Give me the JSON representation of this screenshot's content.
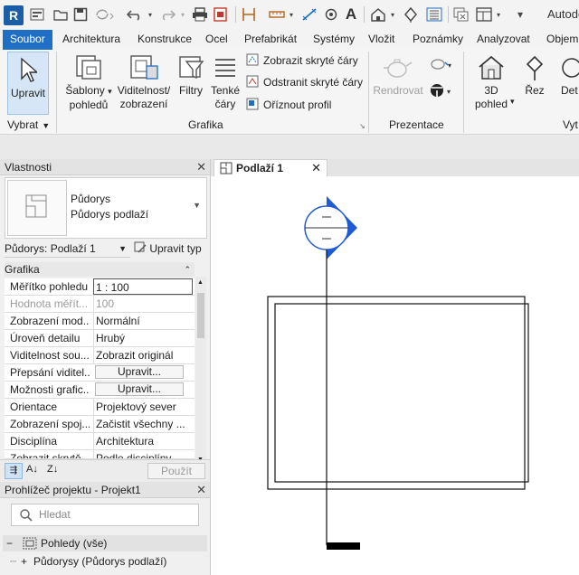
{
  "app": {
    "logo": "R",
    "title": "Autodesk"
  },
  "quick_access": {
    "icons": [
      "info-center-icon",
      "open-icon",
      "save-icon",
      "sync-icon",
      "undo-icon",
      "redo-icon",
      "print-icon",
      "sheet-icon",
      "measure-icon",
      "dimension-icon",
      "tag-icon",
      "text-icon",
      "home-3d-icon",
      "section-icon",
      "thin-lines-icon",
      "close-windows-icon",
      "switch-windows-icon"
    ]
  },
  "tabs": [
    "Soubor",
    "Architektura",
    "Konstrukce",
    "Ocel",
    "Prefabrikát",
    "Systémy",
    "Vložit",
    "Poznámky",
    "Analyzovat",
    "Objem"
  ],
  "ribbon": {
    "select": {
      "label": "Upravit",
      "panel": "Vybrat"
    },
    "graphics": {
      "panel": "Grafika",
      "buttons": [
        {
          "label1": "Šablony",
          "label2": "pohledů"
        },
        {
          "label1": "Viditelnost/",
          "label2": "zobrazení"
        },
        {
          "label1": "Filtry",
          "label2": ""
        },
        {
          "label1": "Tenké",
          "label2": "čáry"
        }
      ],
      "commands": [
        "Zobrazit skryté čáry",
        "Odstranit skryté čáry",
        "Oříznout profil"
      ]
    },
    "presentation": {
      "panel": "Prezentace",
      "render": "Rendrovat"
    },
    "create": {
      "view3d_1": "3D",
      "view3d_2": "pohled",
      "section": "Řez",
      "detail": "Det"
    }
  },
  "properties": {
    "title": "Vlastnosti",
    "type_name": "Půdorys",
    "type_family": "Půdorys podlaží",
    "instance_selector": "Půdorys: Podlaží 1",
    "edit_type": "Upravit typ",
    "group": "Grafika",
    "rows": [
      {
        "name": "Měřítko pohledu",
        "value": "1 : 100"
      },
      {
        "name": "Hodnota měřít...",
        "value": "100"
      },
      {
        "name": "Zobrazení mod...",
        "value": "Normální"
      },
      {
        "name": "Úroveň detailu",
        "value": "Hrubý"
      },
      {
        "name": "Viditelnost sou...",
        "value": "Zobrazit originál"
      },
      {
        "name": "Přepsání viditel...",
        "value": "Upravit..."
      },
      {
        "name": "Možnosti grafic...",
        "value": "Upravit..."
      },
      {
        "name": "Orientace",
        "value": "Projektový sever"
      },
      {
        "name": "Zobrazení spoj...",
        "value": "Začistit všechny ..."
      },
      {
        "name": "Disciplína",
        "value": "Architektura"
      },
      {
        "name": "Zobrazit skrytě...",
        "value": "Podle disciplíny"
      }
    ],
    "apply": "Použít"
  },
  "browser": {
    "title": "Prohlížeč projektu - Projekt1",
    "search_placeholder": "Hledat",
    "node_views": "Pohledy (vše)",
    "node_plans": "Půdorysy (Půdorys podlaží)"
  },
  "view": {
    "tab_label": "Podlaží 1"
  },
  "colors": {
    "accent": "#1f6fc5",
    "elevation_marker": "#1f5bd6"
  }
}
